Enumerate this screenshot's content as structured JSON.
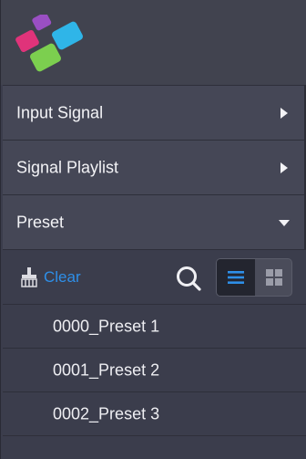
{
  "menu": {
    "items": [
      {
        "label": "Input Signal",
        "icon": "triangle-right-icon"
      },
      {
        "label": "Signal Playlist",
        "icon": "triangle-right-icon"
      },
      {
        "label": "Preset",
        "icon": "triangle-down-icon"
      }
    ]
  },
  "toolbar": {
    "clear_label": "Clear",
    "clear_icon": "broom-icon",
    "search_icon": "search-icon",
    "list_view_icon": "list-view-icon",
    "grid_view_icon": "grid-view-icon",
    "active_view": "list"
  },
  "presets": [
    {
      "name": "0000_Preset 1"
    },
    {
      "name": "0001_Preset 2"
    },
    {
      "name": "0002_Preset 3"
    }
  ],
  "colors": {
    "accent": "#2e8fe8",
    "background": "#3b3d4c",
    "menu_row": "#454756",
    "logo_magenta": "#e0337a",
    "logo_purple": "#9a4fc3",
    "logo_cyan": "#2fb5e8",
    "logo_green": "#7ccf4f"
  }
}
